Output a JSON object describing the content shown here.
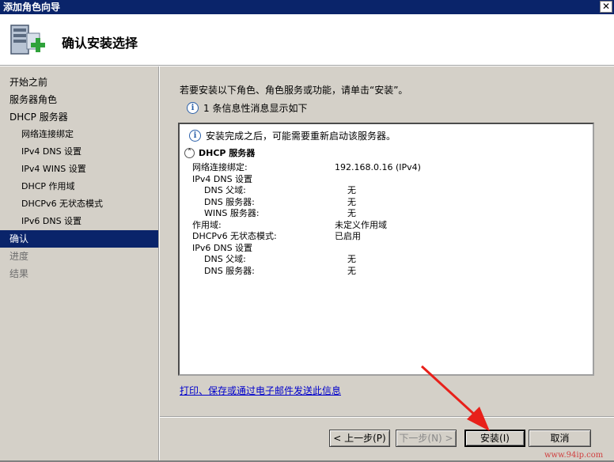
{
  "window": {
    "title": "添加角色向导",
    "close_label": "✕"
  },
  "header": {
    "title": "确认安装选择",
    "icon": "server-add-icon"
  },
  "sidebar": {
    "items": [
      {
        "label": "开始之前",
        "level": 0,
        "state": "normal"
      },
      {
        "label": "服务器角色",
        "level": 0,
        "state": "normal"
      },
      {
        "label": "DHCP 服务器",
        "level": 0,
        "state": "normal"
      },
      {
        "label": "网络连接绑定",
        "level": 1,
        "state": "normal"
      },
      {
        "label": "IPv4 DNS 设置",
        "level": 1,
        "state": "normal"
      },
      {
        "label": "IPv4 WINS 设置",
        "level": 1,
        "state": "normal"
      },
      {
        "label": "DHCP 作用域",
        "level": 1,
        "state": "normal"
      },
      {
        "label": "DHCPv6 无状态模式",
        "level": 1,
        "state": "normal"
      },
      {
        "label": "IPv6 DNS 设置",
        "level": 1,
        "state": "normal"
      },
      {
        "label": "确认",
        "level": 0,
        "state": "active"
      },
      {
        "label": "进度",
        "level": 0,
        "state": "disabled"
      },
      {
        "label": "结果",
        "level": 0,
        "state": "disabled"
      }
    ]
  },
  "main": {
    "intro": "若要安装以下角色、角色服务或功能，请单击“安装”。",
    "info_count": "1 条信息性消息显示如下",
    "details": {
      "info_message": "安装完成之后，可能需要重新启动该服务器。",
      "section_title": "DHCP 服务器",
      "rows": [
        {
          "label": "网络连接绑定:",
          "value": "192.168.0.16 (IPv4)",
          "sub": false
        },
        {
          "label": "IPv4 DNS 设置",
          "value": "",
          "sub": false
        },
        {
          "label": "DNS 父域:",
          "value": "无",
          "sub": true
        },
        {
          "label": "DNS 服务器:",
          "value": "无",
          "sub": true
        },
        {
          "label": "WINS 服务器:",
          "value": "无",
          "sub": true
        },
        {
          "label": "作用域:",
          "value": "未定义作用域",
          "sub": false
        },
        {
          "label": "DHCPv6 无状态模式:",
          "value": "已启用",
          "sub": false
        },
        {
          "label": "IPv6 DNS 设置",
          "value": "",
          "sub": false
        },
        {
          "label": "DNS 父域:",
          "value": "无",
          "sub": true
        },
        {
          "label": "DNS 服务器:",
          "value": "无",
          "sub": true
        }
      ]
    },
    "print_link": "打印、保存或通过电子邮件发送此信息"
  },
  "buttons": {
    "prev": "< 上一步(P)",
    "next": "下一步(N) >",
    "install": "安装(I)",
    "cancel": "取消"
  },
  "watermark": "www.94ip.com",
  "colors": {
    "titlebar": "#0a246a",
    "active": "#0a246a",
    "arrow": "#e8201a"
  }
}
